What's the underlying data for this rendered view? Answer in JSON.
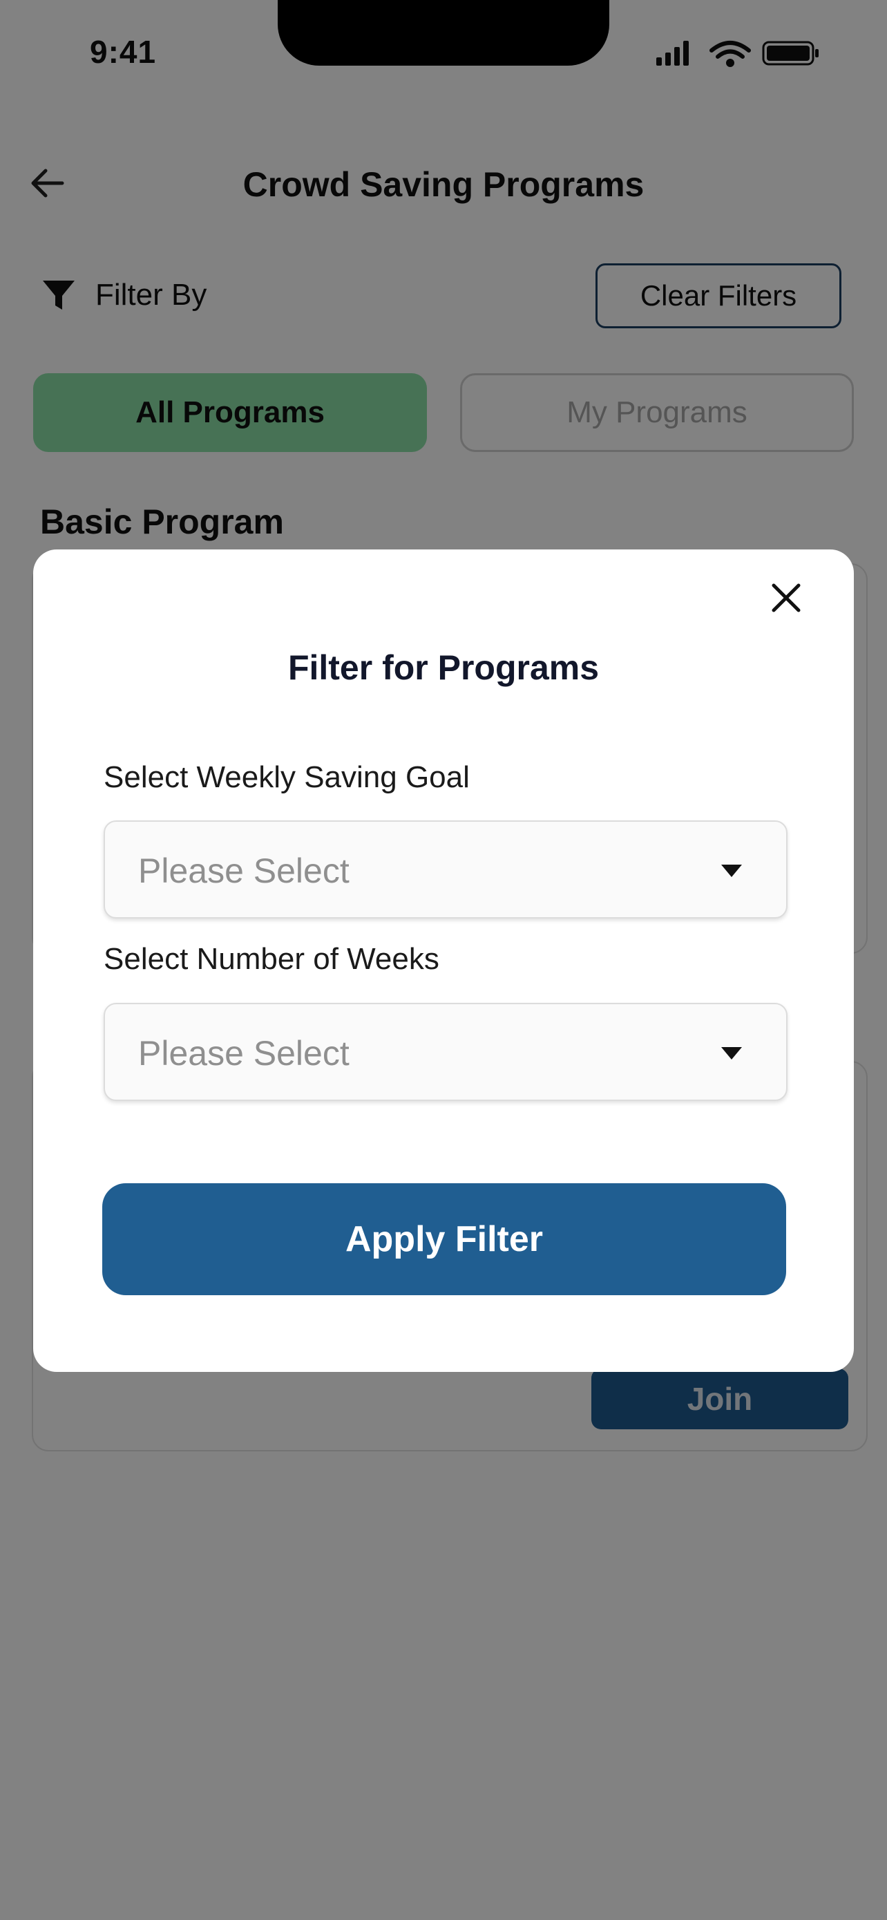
{
  "status_bar": {
    "time": "9:41",
    "icons": [
      "signal-icon",
      "wifi-icon",
      "battery-icon"
    ]
  },
  "header": {
    "title": "Crowd Saving Programs",
    "back_icon": "arrow-left-icon"
  },
  "filter_bar": {
    "label": "Filter By",
    "clear_label": "Clear Filters",
    "icon": "funnel-icon"
  },
  "tabs": [
    {
      "label": "All Programs",
      "selected": true
    },
    {
      "label": "My Programs",
      "selected": false
    }
  ],
  "section": {
    "title": "Basic Program"
  },
  "card": {
    "join_label": "Join"
  },
  "modal": {
    "title": "Filter for Programs",
    "close_icon": "close-icon",
    "fields": [
      {
        "label": "Select Weekly Saving Goal",
        "placeholder": "Please Select"
      },
      {
        "label": "Select Number of Weeks",
        "placeholder": "Please Select"
      }
    ],
    "apply_label": "Apply Filter"
  },
  "colors": {
    "selected_tab": "#8ce0a7",
    "primary": "#205e91",
    "overlay": "rgba(0,0,0,0.49)"
  }
}
